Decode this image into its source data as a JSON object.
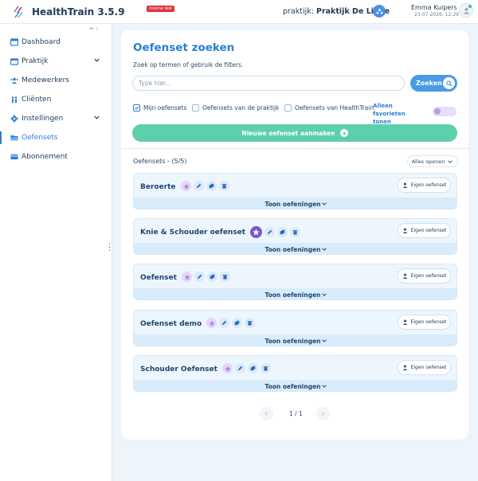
{
  "header": {
    "app_title": "HealthTrain 3.5.9",
    "badge": "Interne test",
    "praktijk_prefix": "praktijk:",
    "praktijk_name": "Praktijk De Linde",
    "user_name": "Emma Kuipers",
    "user_date": "23-07-2026, 12:29"
  },
  "sidebar": {
    "items": [
      {
        "label": "Dashboard",
        "icon": "dashboard-icon"
      },
      {
        "label": "Praktijk",
        "icon": "praktijk-icon",
        "expandable": true
      },
      {
        "label": "Medewerkers",
        "icon": "users-icon"
      },
      {
        "label": "Cliënten",
        "icon": "clients-icon"
      },
      {
        "label": "Instellingen",
        "icon": "gear-icon",
        "expandable": true
      },
      {
        "label": "Oefensets",
        "icon": "folder-icon",
        "active": true
      },
      {
        "label": "Abonnement",
        "icon": "card-icon"
      }
    ]
  },
  "main": {
    "title": "Oefenset zoeken",
    "subtitle": "Zoek op termen of gebruik de filters.",
    "search": {
      "placeholder": "Type hier...",
      "button_label": "Zoeken"
    },
    "filters": {
      "mijn": "Mijn oefensets",
      "praktijk": "Oefensets van de praktijk",
      "healthtrain": "Oefensets van HealthTrain",
      "favorites_label": "Alleen favorieten tonen"
    },
    "new_button": "Nieuwe oefenset aanmaken",
    "list_header": "Oefensets - (5/5)",
    "expand_all": "Alles openen",
    "sets": [
      {
        "name": "Beroerte",
        "favorite": false,
        "owner": "Eigen oefenset",
        "show": "Toon oefeningen"
      },
      {
        "name": "Knie & Schouder oefenset",
        "favorite": true,
        "owner": "Eigen oefenset",
        "show": "Toon oefeningen"
      },
      {
        "name": "Oefenset",
        "favorite": false,
        "owner": "Eigen oefenset",
        "show": "Toon oefeningen"
      },
      {
        "name": "Oefenset demo",
        "favorite": false,
        "owner": "Eigen oefenset",
        "show": "Toon oefeningen"
      },
      {
        "name": "Schouder Oefenset",
        "favorite": false,
        "owner": "Eigen oefenset",
        "show": "Toon oefeningen"
      }
    ],
    "pagination": "1 / 1"
  },
  "colors": {
    "accent": "#2b7fd4",
    "primary_button": "#4a9ae8",
    "new_button": "#5ecfac",
    "favorite_purple": "#7a56d6",
    "badge_red": "#e0313a"
  }
}
